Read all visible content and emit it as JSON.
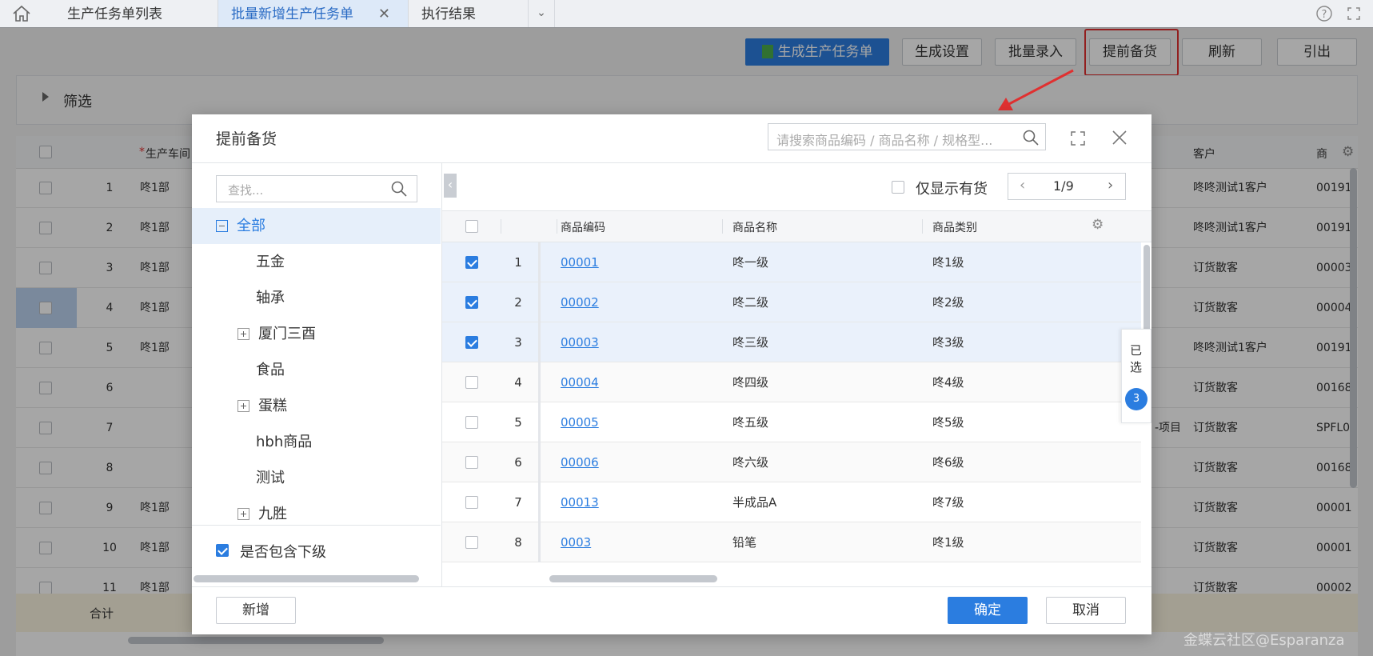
{
  "tabs": {
    "home_icon": "home-icon",
    "items": [
      "生产任务单列表",
      "批量新增生产任务单",
      "执行结果"
    ]
  },
  "toolbar": {
    "generate": "生成生产任务单",
    "settings": "生成设置",
    "batch": "批量录入",
    "prestock": "提前备货",
    "refresh": "刷新",
    "export": "引出"
  },
  "filter": {
    "label": "筛选"
  },
  "bg_grid": {
    "headers": {
      "workshop": "生产车间",
      "customer": "客户",
      "product": "商"
    },
    "rows": [
      {
        "n": "1",
        "workshop": "咚1部",
        "customer": "咚咚测试1客户",
        "code": "00191"
      },
      {
        "n": "2",
        "workshop": "咚1部",
        "customer": "咚咚测试1客户",
        "code": "00191"
      },
      {
        "n": "3",
        "workshop": "咚1部",
        "customer": "订货散客",
        "code": "00003"
      },
      {
        "n": "4",
        "workshop": "咚1部",
        "customer": "订货散客",
        "code": "00004"
      },
      {
        "n": "5",
        "workshop": "咚1部",
        "customer": "咚咚测试1客户",
        "code": "00191"
      },
      {
        "n": "6",
        "workshop": "",
        "customer": "订货散客",
        "code": "00168"
      },
      {
        "n": "7",
        "workshop": "",
        "customer": "订货散客",
        "code": "SPFL0"
      },
      {
        "n": "8",
        "workshop": "",
        "customer": "订货散客",
        "code": "00168"
      },
      {
        "n": "9",
        "workshop": "咚1部",
        "customer": "订货散客",
        "code": "00001"
      },
      {
        "n": "10",
        "workshop": "咚1部",
        "customer": "订货散客",
        "code": "00001"
      },
      {
        "n": "11",
        "workshop": "咚1部",
        "customer": "订货散客",
        "code": "00002"
      }
    ],
    "row7_extra": "-项目",
    "total": "合计"
  },
  "modal": {
    "title": "提前备货",
    "search_placeholder": "请搜索商品编码 / 商品名称 / 规格型...",
    "tree_search_placeholder": "查找...",
    "tree": [
      {
        "label": "全部",
        "expander": "minus"
      },
      {
        "label": "五金",
        "expander": ""
      },
      {
        "label": "轴承",
        "expander": ""
      },
      {
        "label": "厦门三酉",
        "expander": "plus"
      },
      {
        "label": "食品",
        "expander": ""
      },
      {
        "label": "蛋糕",
        "expander": "plus"
      },
      {
        "label": "hbh商品",
        "expander": ""
      },
      {
        "label": "测试",
        "expander": ""
      },
      {
        "label": "九胜",
        "expander": "plus"
      }
    ],
    "include_sub": "是否包含下级",
    "only_stock": "仅显示有货",
    "pager": "1/9",
    "columns": {
      "code": "商品编码",
      "name": "商品名称",
      "category": "商品类别"
    },
    "rows": [
      {
        "n": "1",
        "code": "00001",
        "name": "咚一级",
        "category": "咚1级",
        "checked": true
      },
      {
        "n": "2",
        "code": "00002",
        "name": "咚二级",
        "category": "咚2级",
        "checked": true
      },
      {
        "n": "3",
        "code": "00003",
        "name": "咚三级",
        "category": "咚3级",
        "checked": true
      },
      {
        "n": "4",
        "code": "00004",
        "name": "咚四级",
        "category": "咚4级",
        "checked": false
      },
      {
        "n": "5",
        "code": "00005",
        "name": "咚五级",
        "category": "咚5级",
        "checked": false
      },
      {
        "n": "6",
        "code": "00006",
        "name": "咚六级",
        "category": "咚6级",
        "checked": false
      },
      {
        "n": "7",
        "code": "00013",
        "name": "半成品A",
        "category": "咚7级",
        "checked": false
      },
      {
        "n": "8",
        "code": "0003",
        "name": "铅笔",
        "category": "咚1级",
        "checked": false
      }
    ],
    "selected_label": "已选",
    "selected_count": "3",
    "add": "新增",
    "ok": "确定",
    "cancel": "取消"
  },
  "watermark": "金蝶云社区@Esparanza",
  "colors": {
    "accent": "#2b7de0",
    "highlight": "#e03030"
  }
}
